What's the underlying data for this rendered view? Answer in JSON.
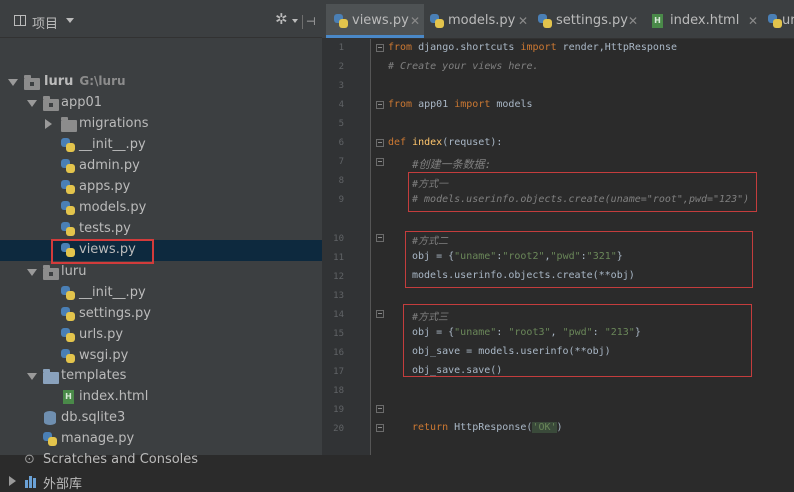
{
  "project_panel": {
    "title": "项目",
    "tree": [
      {
        "label": "luru",
        "sub": "G:\\luru",
        "kind": "root"
      },
      {
        "label": "app01",
        "kind": "folder"
      },
      {
        "label": "migrations",
        "kind": "folder"
      },
      {
        "label": "__init__.py",
        "kind": "py"
      },
      {
        "label": "admin.py",
        "kind": "py"
      },
      {
        "label": "apps.py",
        "kind": "py"
      },
      {
        "label": "models.py",
        "kind": "py"
      },
      {
        "label": "tests.py",
        "kind": "py"
      },
      {
        "label": "views.py",
        "kind": "py"
      },
      {
        "label": "luru",
        "kind": "folder"
      },
      {
        "label": "__init__.py",
        "kind": "py"
      },
      {
        "label": "settings.py",
        "kind": "py"
      },
      {
        "label": "urls.py",
        "kind": "py"
      },
      {
        "label": "wsgi.py",
        "kind": "py"
      },
      {
        "label": "templates",
        "kind": "folder"
      },
      {
        "label": "index.html",
        "kind": "html"
      },
      {
        "label": "db.sqlite3",
        "kind": "db"
      },
      {
        "label": "manage.py",
        "kind": "py"
      },
      {
        "label": "Scratches and Consoles",
        "kind": "scratch"
      },
      {
        "label": "外部库",
        "kind": "lib"
      }
    ]
  },
  "tabs": [
    {
      "label": "views.py",
      "active": true
    },
    {
      "label": "models.py"
    },
    {
      "label": "settings.py"
    },
    {
      "label": "index.html"
    },
    {
      "label": "url"
    }
  ],
  "line_numbers": [
    "1",
    "2",
    "3",
    "4",
    "5",
    "6",
    "7",
    "8",
    "9",
    "10",
    "11",
    "12",
    "13",
    "14",
    "15",
    "16",
    "17",
    "18",
    "19",
    "20",
    "21"
  ],
  "code": {
    "l1": {
      "kw1": "from",
      "mod": " django.shortcuts ",
      "kw2": "import",
      "rest": " render,HttpResponse"
    },
    "l2": "# Create your views here.",
    "l4": {
      "kw1": "from",
      "mod": " app01 ",
      "kw2": "import",
      "rest": " models"
    },
    "l6": {
      "kw": "def",
      "name": " index",
      "rest": "(requset):"
    },
    "l7": "#创建一条数据:",
    "l8": "#方式一",
    "l9": "# models.userinfo.objects.create(uname=\"root\",pwd=\"123\")",
    "l11": "#方式二",
    "l12": {
      "a": "obj = {",
      "s1": "\"uname\"",
      "b": ":",
      "s2": "\"root2\"",
      "c": ",",
      "s3": "\"pwd\"",
      "d": ":",
      "s4": "\"321\"",
      "e": "}"
    },
    "l13": "models.userinfo.objects.create(**obj)",
    "l15": "#方式三",
    "l16": {
      "a": "obj = {",
      "s1": "\"uname\"",
      "b": ": ",
      "s2": "\"root3\"",
      "c": ", ",
      "s3": "\"pwd\"",
      "d": ": ",
      "s4": "\"213\"",
      "e": "}"
    },
    "l17": "obj_save = models.userinfo(**obj)",
    "l18": "obj_save.save()",
    "l21": {
      "kw": "return",
      "call": " HttpResponse(",
      "str": "'OK'",
      "end": ")"
    }
  },
  "colors": {
    "selection": "#0d293e",
    "highlight_box": "#d23b3b",
    "keyword": "#cc7832",
    "string": "#6a8759",
    "comment": "#808080",
    "function": "#ffc66d"
  }
}
